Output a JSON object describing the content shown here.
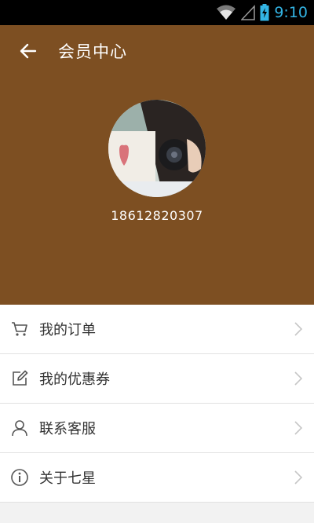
{
  "status": {
    "time": "9:10"
  },
  "toolbar": {
    "title": "会员中心"
  },
  "profile": {
    "phone": "18612820307"
  },
  "menu": {
    "items": [
      {
        "label": "我的订单",
        "icon": "cart-icon"
      },
      {
        "label": "我的优惠券",
        "icon": "edit-icon"
      },
      {
        "label": "联系客服",
        "icon": "user-icon"
      },
      {
        "label": "关于七星",
        "icon": "info-icon"
      }
    ]
  },
  "colors": {
    "header": "#7d4f22",
    "statusAccent": "#33b5e5",
    "background": "#f2f2f2"
  }
}
